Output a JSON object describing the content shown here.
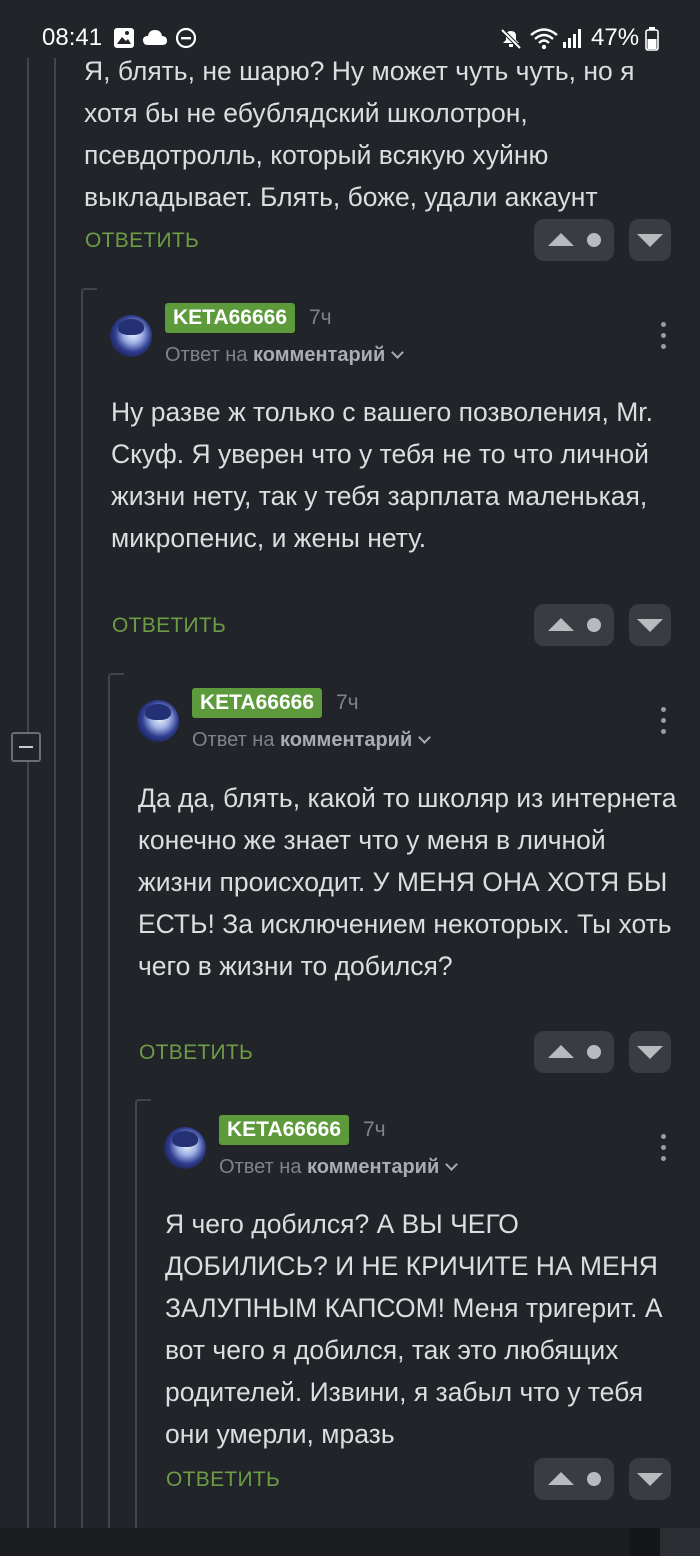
{
  "status_bar": {
    "time": "08:41",
    "battery": "47%",
    "icons": [
      "image-icon",
      "cloud-icon",
      "dnd-icon",
      "mute-icon",
      "wifi-icon",
      "signal-icon",
      "battery-icon"
    ]
  },
  "comments": [
    {
      "text": "Я, блять, не шарю? Ну может чуть чуть, но я хотя бы не ебублядский школотрон, псевдотролль, который всякую хуйню выкладывает. Блять, боже, удали аккаунт",
      "reply_label": "ОТВЕТИТЬ"
    },
    {
      "author": "KETA66666",
      "time": "7ч",
      "reply_prefix": "Ответ на",
      "reply_target": "комментарий",
      "text": "Ну разве ж только с вашего позволения, Mr. Скуф. Я уверен что у тебя не то что личной жизни нету, так у тебя зарплата маленькая, микропенис, и жены нету.",
      "reply_label": "ОТВЕТИТЬ"
    },
    {
      "author": "KETA66666",
      "time": "7ч",
      "reply_prefix": "Ответ на",
      "reply_target": "комментарий",
      "text": "Да да, блять, какой то школяр из интернета конечно же знает что у меня в личной жизни происходит. У МЕНЯ ОНА ХОТЯ БЫ ЕСТЬ! За исключением некоторых. Ты хоть чего в жизни то добился?",
      "reply_label": "ОТВЕТИТЬ"
    },
    {
      "author": "KETA66666",
      "time": "7ч",
      "reply_prefix": "Ответ на",
      "reply_target": "комментарий",
      "text": "Я чего добился? А ВЫ ЧЕГО ДОБИЛИСЬ? И НЕ КРИЧИТЕ НА МЕНЯ ЗАЛУПНЫМ КАПСОМ! Меня тригерит. А вот чего я добился, так это любящих родителей. Извини, я забыл что у тебя они умерли, мразь",
      "reply_label": "ОТВЕТИТЬ"
    }
  ],
  "colors": {
    "background": "#212428",
    "accent_green": "#6d9c45",
    "badge_green": "#5c9a3c",
    "text": "#dcdde0",
    "muted": "#80848a"
  }
}
